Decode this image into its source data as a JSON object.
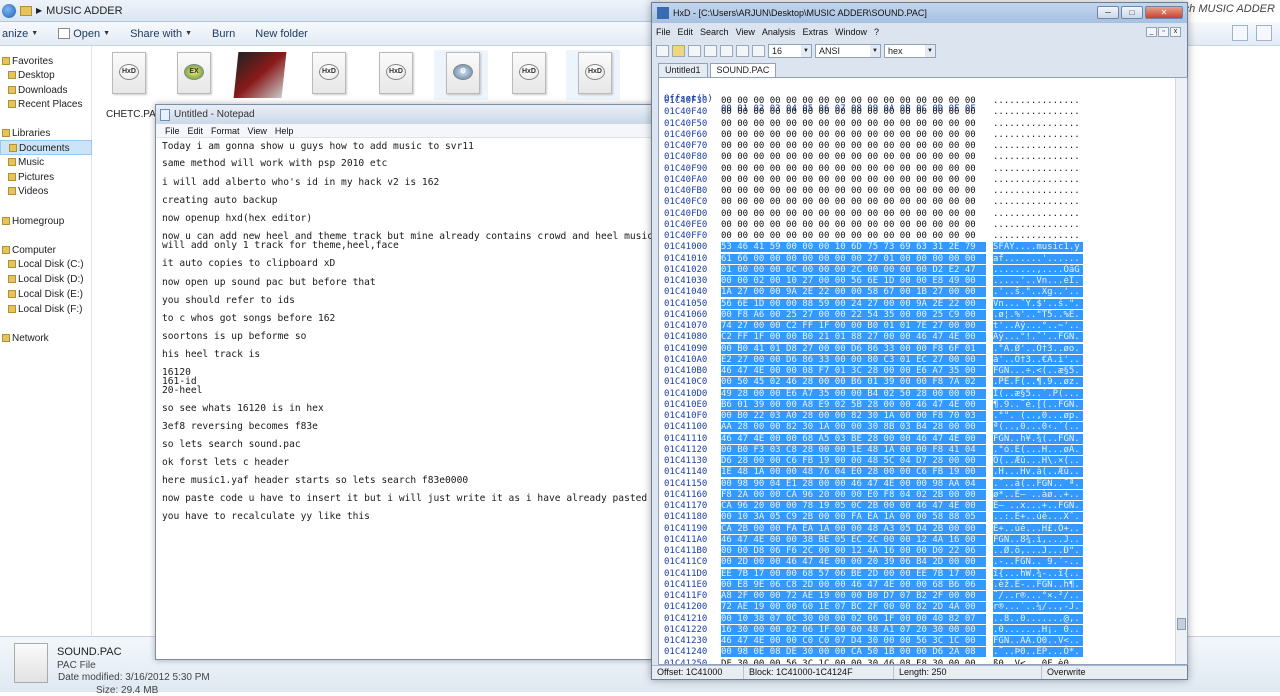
{
  "explorer": {
    "breadcrumb": "MUSIC ADDER",
    "search_placeholder": "rch MUSIC ADDER",
    "toolbar": [
      "anize",
      "Open",
      "Share with",
      "Burn",
      "New folder"
    ],
    "nav": [
      {
        "label": "Favorites",
        "group": true
      },
      {
        "label": "Desktop"
      },
      {
        "label": "Downloads"
      },
      {
        "label": "Recent Places"
      },
      {
        "label": "Libraries",
        "group": true
      },
      {
        "label": "Documents",
        "selected": true
      },
      {
        "label": "Music"
      },
      {
        "label": "Pictures"
      },
      {
        "label": "Videos"
      },
      {
        "label": "Homegroup",
        "group": true
      },
      {
        "label": "Computer",
        "group": true
      },
      {
        "label": "Local Disk (C:)"
      },
      {
        "label": "Local Disk (D:)"
      },
      {
        "label": "Local Disk (E:)"
      },
      {
        "label": "Local Disk (F:)"
      },
      {
        "label": "Network",
        "group": true
      }
    ],
    "file_label": "CHETC.PAC",
    "details": {
      "name": "SOUND.PAC",
      "type": "PAC File",
      "modified": "Date modified: 3/16/2012 5:30 PM",
      "size": "Size: 29.4 MB"
    }
  },
  "notepad": {
    "title": "Untitled - Notepad",
    "menu": [
      "File",
      "Edit",
      "Format",
      "View",
      "Help"
    ],
    "lines": [
      "Today i am gonna show u guys how to add music to svr11",
      "same method will work with psp 2010 etc",
      "i will add alberto who's id in my hack v2 is 162",
      "creating auto backup",
      "now openup hxd(hex editor)",
      "now u can add new heel and theme track but mine already contains crowd and heel music so",
      "will add only 1 track for theme,heel,face",
      "it auto copies to clipboard xD",
      "now open up sound pac but before that",
      "you should refer to ids",
      "to c whos got songs before 162",
      "soortons is up beforme so",
      "his heel track is",
      "16120",
      "161-id",
      "20-heel",
      "so see whats 16120 is in hex",
      "3ef8 reversing becomes f83e",
      "so lets search sound.pac",
      "ok forst lets c header",
      "here music1.yaf header starts so lets search f83e0000",
      "now paste code u have to insert it but i will just write it as i have already pasted cod",
      "you have to recalculate yy like this"
    ]
  },
  "hxd": {
    "title": "HxD - [C:\\Users\\ARJUN\\Desktop\\MUSIC ADDER\\SOUND.PAC]",
    "menu": [
      "File",
      "Edit",
      "Search",
      "View",
      "Analysis",
      "Extras",
      "Window",
      "?"
    ],
    "columns_value": "16",
    "charset": "ANSI",
    "base": "hex",
    "tabs": [
      "Untitled1",
      "SOUND.PAC"
    ],
    "header_offset": "Offset(h)",
    "header_cols": "00 01 02 03 04 05 06 07 08 09 0A 0B 0C 0D 0E 0F",
    "rows": [
      {
        "off": "01C40F30",
        "hex": "00 00 00 00 00 00 00 00 00 00 00 00 00 00 00 00",
        "asc": "................"
      },
      {
        "off": "01C40F40",
        "hex": "00 00 00 00 00 00 00 00 00 00 00 00 00 00 00 00",
        "asc": "................"
      },
      {
        "off": "01C40F50",
        "hex": "00 00 00 00 00 00 00 00 00 00 00 00 00 00 00 00",
        "asc": "................"
      },
      {
        "off": "01C40F60",
        "hex": "00 00 00 00 00 00 00 00 00 00 00 00 00 00 00 00",
        "asc": "................"
      },
      {
        "off": "01C40F70",
        "hex": "00 00 00 00 00 00 00 00 00 00 00 00 00 00 00 00",
        "asc": "................"
      },
      {
        "off": "01C40F80",
        "hex": "00 00 00 00 00 00 00 00 00 00 00 00 00 00 00 00",
        "asc": "................"
      },
      {
        "off": "01C40F90",
        "hex": "00 00 00 00 00 00 00 00 00 00 00 00 00 00 00 00",
        "asc": "................"
      },
      {
        "off": "01C40FA0",
        "hex": "00 00 00 00 00 00 00 00 00 00 00 00 00 00 00 00",
        "asc": "................"
      },
      {
        "off": "01C40FB0",
        "hex": "00 00 00 00 00 00 00 00 00 00 00 00 00 00 00 00",
        "asc": "................"
      },
      {
        "off": "01C40FC0",
        "hex": "00 00 00 00 00 00 00 00 00 00 00 00 00 00 00 00",
        "asc": "................"
      },
      {
        "off": "01C40FD0",
        "hex": "00 00 00 00 00 00 00 00 00 00 00 00 00 00 00 00",
        "asc": "................"
      },
      {
        "off": "01C40FE0",
        "hex": "00 00 00 00 00 00 00 00 00 00 00 00 00 00 00 00",
        "asc": "................"
      },
      {
        "off": "01C40FF0",
        "hex": "00 00 00 00 00 00 00 00 00 00 00 00 00 00 00 00",
        "asc": "................"
      },
      {
        "off": "01C41000",
        "hex": "53 46 41 59 00 00 00 10 6D 75 73 69 63 31 2E 79",
        "asc": "SFAY....music1.y",
        "sel": true
      },
      {
        "off": "01C41010",
        "hex": "61 66 00 00 00 00 00 00 00 27 01 00 00 00 00 00",
        "asc": "af.......'......",
        "sel": true
      },
      {
        "off": "01C41020",
        "hex": "01 00 00 00 0C 00 00 00 2C 00 00 00 00 D2 E2 47",
        "asc": "........,....ÒâG",
        "sel": true
      },
      {
        "off": "01C41030",
        "hex": "00 00 02 00 10 27 00 00 56 6E 1D 00 00 E8 49 00",
        "asc": ".....'..Vn...èI.",
        "sel": true
      },
      {
        "off": "01C41040",
        "hex": "1A 27 00 00 9A 2E 22 00 00 58 67 00 1B 27 00 00",
        "asc": ".'..š.\"..Xg..'..",
        "sel": true
      },
      {
        "off": "01C41050",
        "hex": "56 6E 1D 00 00 88 59 00 24 27 00 00 9A 2E 22 00",
        "asc": "Vn...ˆY.$'..š.\".",
        "sel": true
      },
      {
        "off": "01C41060",
        "hex": "00 F8 A6 00 25 27 00 00 22 54 35 00 00 25 C9 00",
        "asc": ".ø¦.%'..\"T5..%É.",
        "sel": true
      },
      {
        "off": "01C41070",
        "hex": "74 27 00 00 C2 FF 1F 00 00 B0 01 01 7E 27 00 00",
        "asc": "t'..Âÿ...°..~'..",
        "sel": true
      },
      {
        "off": "01C41080",
        "hex": "C2 FF 1F 00 00 B0 21 01 88 27 00 00 46 47 4E 00",
        "asc": "Âÿ...°!.ˆ'..FGN.",
        "sel": true
      },
      {
        "off": "01C41090",
        "hex": "00 B0 41 01 D8 27 00 00 D6 86 33 00 00 F8 6F 01",
        "asc": ".°A.Ø'..Ö†3..øo.",
        "sel": true
      },
      {
        "off": "01C410A0",
        "hex": "E2 27 00 00 D6 86 33 00 00 80 C3 01 EC 27 00 00",
        "asc": "â'..Ö†3..€Ã.ì'..",
        "sel": true
      },
      {
        "off": "01C410B0",
        "hex": "46 47 4E 00 00 08 F7 01 3C 28 00 00 E6 A7 35 00",
        "asc": "FGN...÷.<(..æ§5.",
        "sel": true
      },
      {
        "off": "01C410C0",
        "hex": "00 50 45 02 46 28 00 00 B6 01 39 00 00 F8 7A 02",
        "asc": ".PE.F(..¶.9..øz.",
        "sel": true
      },
      {
        "off": "01C410D0",
        "hex": "49 28 00 00 E6 A7 35 00 00 B4 02 50 28 00 00 00",
        "asc": "I(..æ§5..´.P(...",
        "sel": true
      },
      {
        "off": "01C410E0",
        "hex": "B6 01 39 00 00 A8 E9 02 5B 28 00 00 46 47 4E 00",
        "asc": "¶.9..¨é.[(..FGN.",
        "sel": true
      },
      {
        "off": "01C410F0",
        "hex": "00 B0 22 03 A0 28 00 00 82 30 1A 00 00 F8 70 03",
        "asc": ".°\". (..‚0...øp.",
        "sel": true
      },
      {
        "off": "01C41100",
        "hex": "AA 28 00 00 82 30 1A 00 00 30 8B 03 B4 28 00 00",
        "asc": "ª(..‚0...0‹.´(..",
        "sel": true
      },
      {
        "off": "01C41110",
        "hex": "46 47 4E 00 00 68 A5 03 BE 28 00 00 46 47 4E 00",
        "asc": "FGN..h¥.¾(..FGN.",
        "sel": true
      },
      {
        "off": "01C41120",
        "hex": "00 B0 F3 03 C8 28 00 00 1E 48 1A 00 00 F8 41 04",
        "asc": ".°ó.È(...H...øA.",
        "sel": true
      },
      {
        "off": "01C41130",
        "hex": "D6 28 00 00 C6 FB 19 00 00 48 5C 04 D7 28 00 00",
        "asc": "Ö(..Æû...H\\.×(..",
        "sel": true
      },
      {
        "off": "01C41140",
        "hex": "1E 48 1A 00 00 48 76 04 E0 28 00 00 C6 FB 19 00",
        "asc": ".H...Hv.à(..Æû..",
        "sel": true
      },
      {
        "off": "01C41150",
        "hex": "00 98 90 04 E1 28 00 00 46 47 4E 00 00 98 AA 04",
        "asc": ".˜..á(..FGN..˜ª.",
        "sel": true
      },
      {
        "off": "01C41160",
        "hex": "F8 2A 00 00 CA 96 20 00 00 E0 F8 04 02 2B 00 00",
        "asc": "ø*..Ê– ..àø..+..",
        "sel": true
      },
      {
        "off": "01C41170",
        "hex": "CA 96 20 00 00 78 19 05 0C 2B 00 00 46 47 4E 00",
        "asc": "Ê– ..x...+..FGN.",
        "sel": true
      },
      {
        "off": "01C41180",
        "hex": "00 10 3A 05 C9 2B 00 00 FA EA 1A 00 00 58 88 05",
        "asc": "..:.É+..úê...Xˆ.",
        "sel": true
      },
      {
        "off": "01C41190",
        "hex": "CA 2B 00 00 FA EA 1A 00 00 48 A3 05 D4 2B 00 00",
        "asc": "Ê+..úê...H£.Ô+..",
        "sel": true
      },
      {
        "off": "01C411A0",
        "hex": "46 47 4E 00 00 38 BE 05 EC 2C 00 00 12 4A 16 00",
        "asc": "FGN..8¾.ì,...J..",
        "sel": true
      },
      {
        "off": "01C411B0",
        "hex": "00 00 D8 06 F6 2C 00 00 12 4A 16 00 00 D0 22 06",
        "asc": "..Ø.ö,...J...Ð\".",
        "sel": true
      },
      {
        "off": "01C411C0",
        "hex": "00 2D 00 00 46 47 4E 00 00 20 39 06 B4 2D 00 00",
        "asc": ".-..FGN.. 9.´-..",
        "sel": true
      },
      {
        "off": "01C411D0",
        "hex": "EE 7B 17 00 00 68 57 06 BE 2D 00 00 EE 7B 17 00",
        "asc": "î{...hW.¾-..î{..",
        "sel": true
      },
      {
        "off": "01C411E0",
        "hex": "00 E8 9E 06 C8 2D 00 00 46 47 4E 00 00 68 B6 06",
        "asc": ".èž.È-..FGN..h¶.",
        "sel": true
      },
      {
        "off": "01C411F0",
        "hex": "A8 2F 00 00 72 AE 19 00 00 B0 D7 07 B2 2F 00 00",
        "asc": "¨/..r®...°×.²/..",
        "sel": true
      },
      {
        "off": "01C41200",
        "hex": "72 AE 19 00 00 60 1E 07 BC 2F 00 00 82 2D 4A 00",
        "asc": "r®...`..¼/..‚-J.",
        "sel": true
      },
      {
        "off": "01C41210",
        "hex": "00 10 38 07 0C 30 00 00 02 06 1F 00 00 40 82 07",
        "asc": "..8..0.......@‚.",
        "sel": true
      },
      {
        "off": "01C41220",
        "hex": "16 30 00 00 02 06 1F 00 00 48 A1 07 20 30 00 00",
        "asc": ".0.......H¡. 0..",
        "sel": true
      },
      {
        "off": "01C41230",
        "hex": "46 47 4E 00 00 C0 C0 07 D4 30 00 00 56 3C 1C 00",
        "asc": "FGN..ÀÀ.Ô0..V<..",
        "sel": true
      },
      {
        "off": "01C41240",
        "hex": "00 98 0E 08 DE 30 00 00 CA 50 1B 00 00 D6 2A 08",
        "asc": ".˜..Þ0..ÊP...Ö*.",
        "sel": true
      },
      {
        "off": "01C41250",
        "hex": "DF 30 00 00 56 3C 1C 00 00 30 46 08 E8 30 00 00",
        "asc": "ß0..V<...0F.è0.."
      }
    ],
    "status": {
      "offset": "Offset: 1C41000",
      "block": "Block: 1C41000-1C4124F",
      "length": "Length: 250",
      "mode": "Overwrite"
    }
  }
}
